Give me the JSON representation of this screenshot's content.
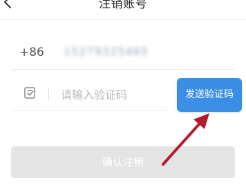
{
  "header": {
    "title": "注销账号",
    "back_icon": "chevron-left-icon"
  },
  "phone": {
    "country_code": "+86",
    "number": "15279325465"
  },
  "code": {
    "icon": "verification-code-icon",
    "placeholder": "请输入验证码",
    "value": "",
    "send_button_label": "发送验证码"
  },
  "confirm_button_label": "确认注销",
  "colors": {
    "primary": "#3a8ee6",
    "disabled_button": "#e4e4e4",
    "annotation_arrow": "#b01c2e"
  }
}
